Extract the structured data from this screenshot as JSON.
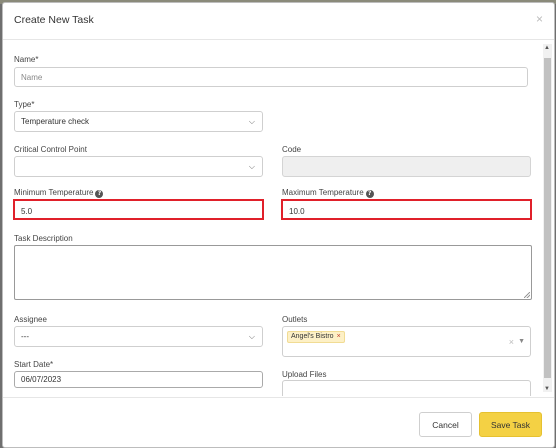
{
  "modal": {
    "title": "Create New Task",
    "close": "×"
  },
  "form": {
    "name": {
      "label": "Name*",
      "placeholder": "Name"
    },
    "type": {
      "label": "Type*",
      "value": "Temperature check"
    },
    "ccp": {
      "label": "Critical Control Point",
      "value": ""
    },
    "code": {
      "label": "Code",
      "value": ""
    },
    "min_temp": {
      "label": "Minimum Temperature",
      "value": "5.0"
    },
    "max_temp": {
      "label": "Maximum Temperature",
      "value": "10.0"
    },
    "description": {
      "label": "Task Description",
      "value": ""
    },
    "assignee": {
      "label": "Assignee",
      "value": "---"
    },
    "outlets": {
      "label": "Outlets",
      "tag": "Angel's Bistro",
      "tag_remove": "×",
      "clear": "×"
    },
    "start_date": {
      "label": "Start Date*",
      "value": "06/07/2023"
    },
    "upload": {
      "label": "Upload Files"
    },
    "help_glyph": "?"
  },
  "footer": {
    "cancel_label": "Cancel",
    "save_label": "Save Task"
  },
  "colors": {
    "highlight": "#e0202a",
    "save_button": "#f4d144",
    "tag_bg": "#fdf0c6"
  }
}
